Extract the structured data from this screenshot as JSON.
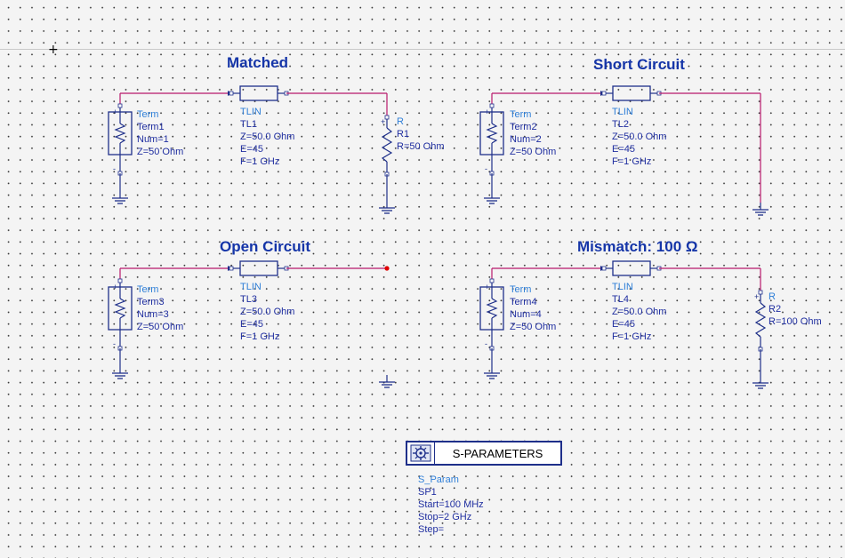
{
  "colors": {
    "wire": "#b8186b",
    "component": "#1e2f8a",
    "title": "#1535a8",
    "label": "#1f2ea0",
    "label_header": "#2f7fd8",
    "open_node": "#e00000"
  },
  "circuits": [
    {
      "title": "Matched",
      "term": {
        "type": "Term",
        "name": "Term1",
        "num": "Num=1",
        "z": "Z=50 Ohm"
      },
      "tl": {
        "type": "TLIN",
        "name": "TL1",
        "z": "Z=50.0 Ohm",
        "e": "E=45",
        "f": "F=1 GHz"
      },
      "load": {
        "type": "R",
        "name": "R1",
        "value": "R=50 Ohm"
      }
    },
    {
      "title": "Short Circuit",
      "term": {
        "type": "Term",
        "name": "Term2",
        "num": "Num=2",
        "z": "Z=50 Ohm"
      },
      "tl": {
        "type": "TLIN",
        "name": "TL2",
        "z": "Z=50.0 Ohm",
        "e": "E=45",
        "f": "F=1 GHz"
      }
    },
    {
      "title": "Open Circuit",
      "term": {
        "type": "Term",
        "name": "Term3",
        "num": "Num=3",
        "z": "Z=50 Ohm"
      },
      "tl": {
        "type": "TLIN",
        "name": "TL3",
        "z": "Z=50.0 Ohm",
        "e": "E=45",
        "f": "F=1 GHz"
      }
    },
    {
      "title": "Mismatch: 100 Ω",
      "term": {
        "type": "Term",
        "name": "Term4",
        "num": "Num=4",
        "z": "Z=50 Ohm"
      },
      "tl": {
        "type": "TLIN",
        "name": "TL4",
        "z": "Z=50.0 Ohm",
        "e": "E=45",
        "f": "F=1 GHz"
      },
      "load": {
        "type": "R",
        "name": "R2",
        "value": "R=100 Ohm"
      }
    }
  ],
  "sparam": {
    "box_label": "S-PARAMETERS",
    "type": "S_Param",
    "name": "SP1",
    "start": "Start=100 MHz",
    "stop": "Stop=2 GHz",
    "step": "Step="
  }
}
